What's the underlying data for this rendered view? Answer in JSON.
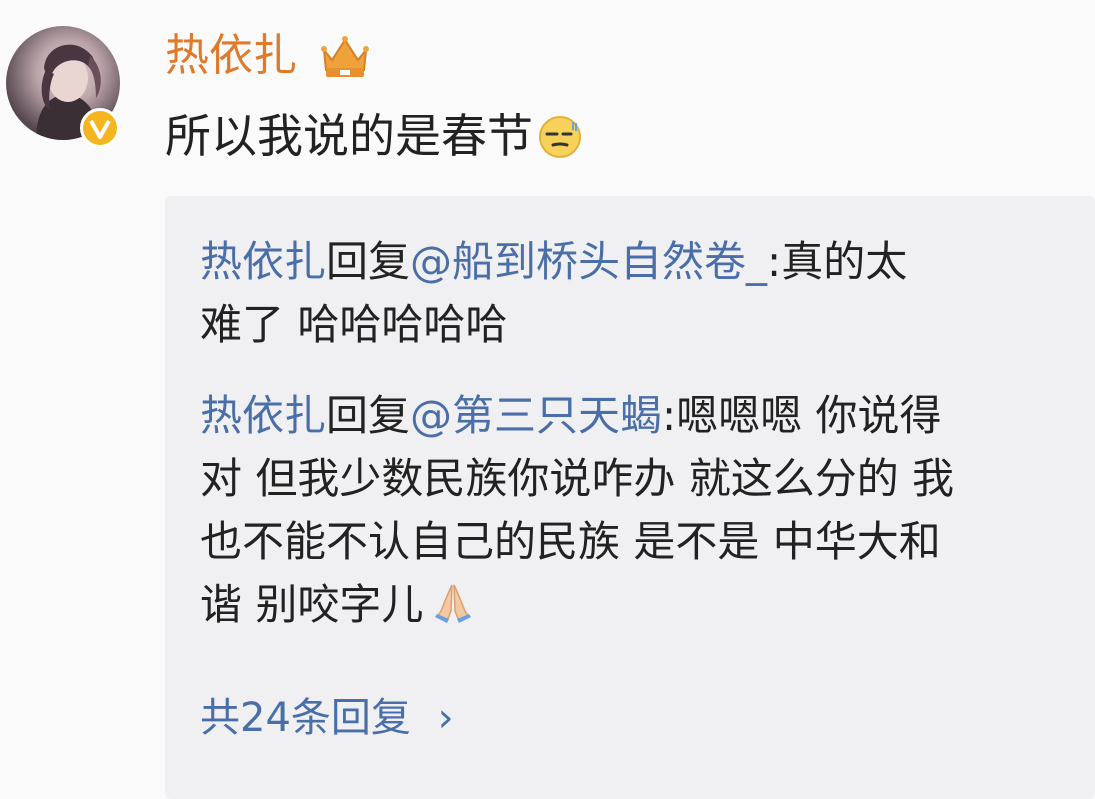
{
  "comment": {
    "username": "热依扎",
    "text": "所以我说的是春节",
    "username_color": "#e07a2b",
    "badge_icon": "crown-icon",
    "verified_icon": "verified-v-icon",
    "emoji_icon": "embarrassed-face-emoji"
  },
  "replies": [
    {
      "author": "热依扎",
      "action": "回复",
      "target": "@船到桥头自然卷_",
      "text_line1": ":真的太",
      "text_line2": "难了 哈哈哈哈哈"
    },
    {
      "author": "热依扎",
      "action": "回复",
      "target": "@第三只天蝎",
      "text_line1": ":嗯嗯嗯 你说得",
      "text_line2": "对 但我少数民族你说咋办 就这么分的 我",
      "text_line3": "也不能不认自己的民族 是不是 中华大和",
      "text_line4": "谐 别咬字儿",
      "emoji_icon": "praying-hands-emoji"
    }
  ],
  "more_replies": {
    "label": "共24条回复",
    "chevron": "›"
  },
  "colors": {
    "link_blue": "#4a6ea8",
    "reply_bg": "#f0f0f2",
    "text": "#222222"
  }
}
